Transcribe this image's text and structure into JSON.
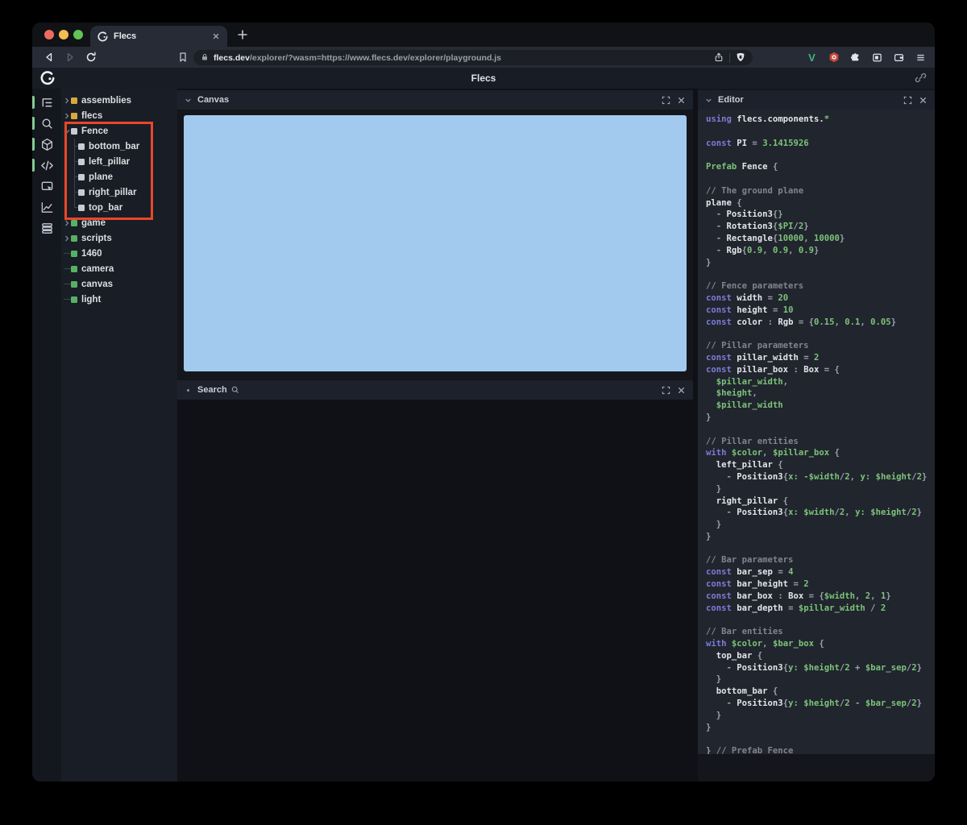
{
  "browser": {
    "tab": {
      "title": "Flecs"
    },
    "url": {
      "host": "flecs.dev",
      "path": "/explorer/?wasm=https://www.flecs.dev/explorer/playground.js"
    },
    "extensions": [
      "v-extension-icon",
      "hexagon-extension-icon",
      "puzzle-icon",
      "sidebar-toggle-icon",
      "wallet-icon",
      "menu-icon"
    ]
  },
  "app": {
    "title": "Flecs"
  },
  "leftbar": {
    "items": [
      {
        "icon": "tree-icon",
        "active": true
      },
      {
        "icon": "search-icon",
        "active": true
      },
      {
        "icon": "cube-icon",
        "active": true
      },
      {
        "icon": "code-icon",
        "active": true
      },
      {
        "icon": "inspect-icon",
        "active": false
      },
      {
        "icon": "stats-icon",
        "active": false
      },
      {
        "icon": "rows-icon",
        "active": false
      }
    ]
  },
  "tree": {
    "items": [
      {
        "label": "assemblies",
        "kind": "collapsed",
        "color": "yellow"
      },
      {
        "label": "flecs",
        "kind": "collapsed",
        "color": "yellow"
      },
      {
        "label": "Fence",
        "kind": "expanded",
        "color": "white"
      },
      {
        "label": "bottom_bar",
        "kind": "child",
        "color": "white"
      },
      {
        "label": "left_pillar",
        "kind": "child",
        "color": "white"
      },
      {
        "label": "plane",
        "kind": "child",
        "color": "white"
      },
      {
        "label": "right_pillar",
        "kind": "child",
        "color": "white"
      },
      {
        "label": "top_bar",
        "kind": "child-last",
        "color": "white"
      },
      {
        "label": "game",
        "kind": "collapsed",
        "color": "green"
      },
      {
        "label": "scripts",
        "kind": "collapsed",
        "color": "green"
      },
      {
        "label": "1460",
        "kind": "leaf",
        "color": "green"
      },
      {
        "label": "camera",
        "kind": "leaf",
        "color": "green"
      },
      {
        "label": "canvas",
        "kind": "leaf",
        "color": "green"
      },
      {
        "label": "light",
        "kind": "leaf",
        "color": "green"
      }
    ]
  },
  "panels": {
    "canvas": {
      "title": "Canvas"
    },
    "search": {
      "title": "Search"
    },
    "editor": {
      "title": "Editor"
    }
  },
  "colors": {
    "canvas_fill": "#a2c9ee",
    "annotation_red": "#e8472b",
    "accent_green_pill": "#84cb96",
    "square_yellow": "#d7a83e",
    "square_green": "#57b165",
    "square_white": "#c9cdd3"
  },
  "editor": {
    "code_lines": [
      [
        [
          "k",
          "using "
        ],
        [
          "w",
          "flecs.components."
        ],
        [
          "g",
          "*"
        ]
      ],
      [],
      [
        [
          "k",
          "const "
        ],
        [
          "w",
          "PI "
        ],
        [
          "p",
          "= "
        ],
        [
          "g",
          "3.1415926"
        ]
      ],
      [],
      [
        [
          "g",
          "Prefab "
        ],
        [
          "w",
          "Fence "
        ],
        [
          "p",
          "{"
        ]
      ],
      [],
      [
        [
          "c",
          "// The ground plane"
        ]
      ],
      [
        [
          "w",
          "plane "
        ],
        [
          "p",
          "{"
        ]
      ],
      [
        [
          "p",
          "  - "
        ],
        [
          "w",
          "Position3"
        ],
        [
          "p",
          "{}"
        ]
      ],
      [
        [
          "p",
          "  - "
        ],
        [
          "w",
          "Rotation3"
        ],
        [
          "p",
          "{"
        ],
        [
          "g",
          "$PI"
        ],
        [
          "p",
          "/"
        ],
        [
          "g",
          "2"
        ],
        [
          "p",
          "}"
        ]
      ],
      [
        [
          "p",
          "  - "
        ],
        [
          "w",
          "Rectangle"
        ],
        [
          "p",
          "{"
        ],
        [
          "g",
          "10000"
        ],
        [
          "p",
          ", "
        ],
        [
          "g",
          "10000"
        ],
        [
          "p",
          "}"
        ]
      ],
      [
        [
          "p",
          "  - "
        ],
        [
          "w",
          "Rgb"
        ],
        [
          "p",
          "{"
        ],
        [
          "g",
          "0.9"
        ],
        [
          "p",
          ", "
        ],
        [
          "g",
          "0.9"
        ],
        [
          "p",
          ", "
        ],
        [
          "g",
          "0.9"
        ],
        [
          "p",
          "}"
        ]
      ],
      [
        [
          "p",
          "}"
        ]
      ],
      [],
      [
        [
          "c",
          "// Fence parameters"
        ]
      ],
      [
        [
          "k",
          "const "
        ],
        [
          "w",
          "width "
        ],
        [
          "p",
          "= "
        ],
        [
          "g",
          "20"
        ]
      ],
      [
        [
          "k",
          "const "
        ],
        [
          "w",
          "height "
        ],
        [
          "p",
          "= "
        ],
        [
          "g",
          "10"
        ]
      ],
      [
        [
          "k",
          "const "
        ],
        [
          "w",
          "color "
        ],
        [
          "p",
          ": "
        ],
        [
          "w",
          "Rgb "
        ],
        [
          "p",
          "= {"
        ],
        [
          "g",
          "0.15"
        ],
        [
          "p",
          ", "
        ],
        [
          "g",
          "0.1"
        ],
        [
          "p",
          ", "
        ],
        [
          "g",
          "0.05"
        ],
        [
          "p",
          "}"
        ]
      ],
      [],
      [
        [
          "c",
          "// Pillar parameters"
        ]
      ],
      [
        [
          "k",
          "const "
        ],
        [
          "w",
          "pillar_width "
        ],
        [
          "p",
          "= "
        ],
        [
          "g",
          "2"
        ]
      ],
      [
        [
          "k",
          "const "
        ],
        [
          "w",
          "pillar_box "
        ],
        [
          "p",
          ": "
        ],
        [
          "w",
          "Box "
        ],
        [
          "p",
          "= {"
        ]
      ],
      [
        [
          "g",
          "  $pillar_width"
        ],
        [
          "p",
          ","
        ]
      ],
      [
        [
          "g",
          "  $height"
        ],
        [
          "p",
          ","
        ]
      ],
      [
        [
          "g",
          "  $pillar_width"
        ]
      ],
      [
        [
          "p",
          "}"
        ]
      ],
      [],
      [
        [
          "c",
          "// Pillar entities"
        ]
      ],
      [
        [
          "k",
          "with "
        ],
        [
          "g",
          "$color"
        ],
        [
          "p",
          ", "
        ],
        [
          "g",
          "$pillar_box "
        ],
        [
          "p",
          "{"
        ]
      ],
      [
        [
          "w",
          "  left_pillar "
        ],
        [
          "p",
          "{"
        ]
      ],
      [
        [
          "p",
          "    - "
        ],
        [
          "w",
          "Position3"
        ],
        [
          "p",
          "{"
        ],
        [
          "g",
          "x:"
        ],
        [
          "p",
          " -"
        ],
        [
          "g",
          "$width"
        ],
        [
          "p",
          "/"
        ],
        [
          "g",
          "2"
        ],
        [
          "p",
          ", "
        ],
        [
          "g",
          "y:"
        ],
        [
          "p",
          " "
        ],
        [
          "g",
          "$height"
        ],
        [
          "p",
          "/"
        ],
        [
          "g",
          "2"
        ],
        [
          "p",
          "}"
        ]
      ],
      [
        [
          "p",
          "  }"
        ]
      ],
      [
        [
          "w",
          "  right_pillar "
        ],
        [
          "p",
          "{"
        ]
      ],
      [
        [
          "p",
          "    - "
        ],
        [
          "w",
          "Position3"
        ],
        [
          "p",
          "{"
        ],
        [
          "g",
          "x:"
        ],
        [
          "p",
          " "
        ],
        [
          "g",
          "$width"
        ],
        [
          "p",
          "/"
        ],
        [
          "g",
          "2"
        ],
        [
          "p",
          ", "
        ],
        [
          "g",
          "y:"
        ],
        [
          "p",
          " "
        ],
        [
          "g",
          "$height"
        ],
        [
          "p",
          "/"
        ],
        [
          "g",
          "2"
        ],
        [
          "p",
          "}"
        ]
      ],
      [
        [
          "p",
          "  }"
        ]
      ],
      [
        [
          "p",
          "}"
        ]
      ],
      [],
      [
        [
          "c",
          "// Bar parameters"
        ]
      ],
      [
        [
          "k",
          "const "
        ],
        [
          "w",
          "bar_sep "
        ],
        [
          "p",
          "= "
        ],
        [
          "g",
          "4"
        ]
      ],
      [
        [
          "k",
          "const "
        ],
        [
          "w",
          "bar_height "
        ],
        [
          "p",
          "= "
        ],
        [
          "g",
          "2"
        ]
      ],
      [
        [
          "k",
          "const "
        ],
        [
          "w",
          "bar_box "
        ],
        [
          "p",
          ": "
        ],
        [
          "w",
          "Box "
        ],
        [
          "p",
          "= {"
        ],
        [
          "g",
          "$width"
        ],
        [
          "p",
          ", "
        ],
        [
          "g",
          "2"
        ],
        [
          "p",
          ", "
        ],
        [
          "g",
          "1"
        ],
        [
          "p",
          "}"
        ]
      ],
      [
        [
          "k",
          "const "
        ],
        [
          "w",
          "bar_depth "
        ],
        [
          "p",
          "= "
        ],
        [
          "g",
          "$pillar_width "
        ],
        [
          "p",
          "/ "
        ],
        [
          "g",
          "2"
        ]
      ],
      [],
      [
        [
          "c",
          "// Bar entities"
        ]
      ],
      [
        [
          "k",
          "with "
        ],
        [
          "g",
          "$color"
        ],
        [
          "p",
          ", "
        ],
        [
          "g",
          "$bar_box "
        ],
        [
          "p",
          "{"
        ]
      ],
      [
        [
          "w",
          "  top_bar "
        ],
        [
          "p",
          "{"
        ]
      ],
      [
        [
          "p",
          "    - "
        ],
        [
          "w",
          "Position3"
        ],
        [
          "p",
          "{"
        ],
        [
          "g",
          "y:"
        ],
        [
          "p",
          " "
        ],
        [
          "g",
          "$height"
        ],
        [
          "p",
          "/"
        ],
        [
          "g",
          "2"
        ],
        [
          "p",
          " + "
        ],
        [
          "g",
          "$bar_sep"
        ],
        [
          "p",
          "/"
        ],
        [
          "g",
          "2"
        ],
        [
          "p",
          "}"
        ]
      ],
      [
        [
          "p",
          "  }"
        ]
      ],
      [
        [
          "w",
          "  bottom_bar "
        ],
        [
          "p",
          "{"
        ]
      ],
      [
        [
          "p",
          "    - "
        ],
        [
          "w",
          "Position3"
        ],
        [
          "p",
          "{"
        ],
        [
          "g",
          "y:"
        ],
        [
          "p",
          " "
        ],
        [
          "g",
          "$height"
        ],
        [
          "p",
          "/"
        ],
        [
          "g",
          "2"
        ],
        [
          "p",
          " - "
        ],
        [
          "g",
          "$bar_sep"
        ],
        [
          "p",
          "/"
        ],
        [
          "g",
          "2"
        ],
        [
          "p",
          "}"
        ]
      ],
      [
        [
          "p",
          "  }"
        ]
      ],
      [
        [
          "p",
          "}"
        ]
      ],
      [],
      [
        [
          "p",
          "} "
        ],
        [
          "c",
          "// Prefab Fence"
        ]
      ]
    ]
  }
}
